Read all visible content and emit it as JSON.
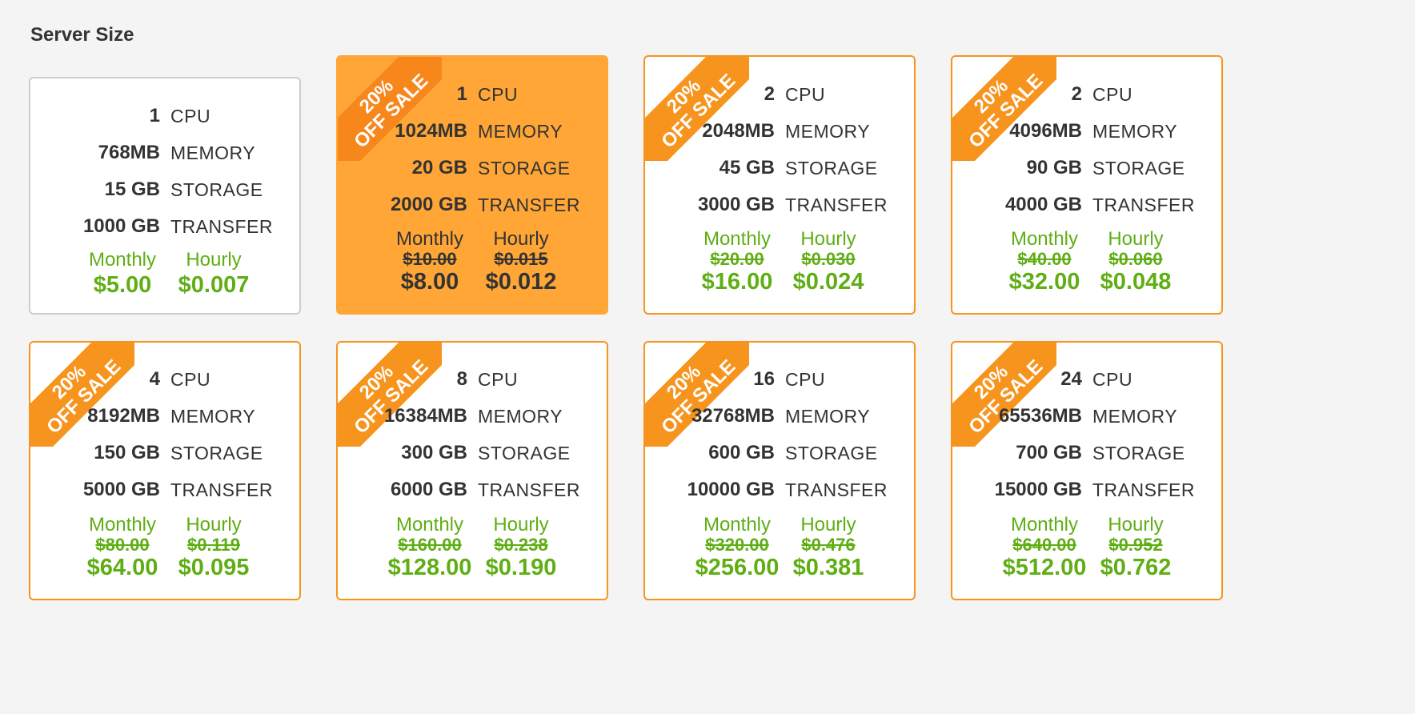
{
  "section": {
    "title": "Server Size"
  },
  "labels": {
    "cpu": "CPU",
    "memory": "MEMORY",
    "storage": "STORAGE",
    "transfer": "TRANSFER",
    "monthly": "Monthly",
    "hourly": "Hourly",
    "ribbon_line1": "20%",
    "ribbon_line2": "OFF SALE"
  },
  "colors": {
    "accent_orange": "#f7941d",
    "selected_bg": "#ffa636",
    "price_green": "#5fae14",
    "border_gray": "#c9ced1"
  },
  "plans": [
    {
      "cpu": "1",
      "memory": "768MB",
      "storage": "15 GB",
      "transfer": "1000 GB",
      "monthly_old": "",
      "hourly_old": "",
      "monthly": "$5.00",
      "hourly": "$0.007",
      "sale": false,
      "selected": false
    },
    {
      "cpu": "1",
      "memory": "1024MB",
      "storage": "20 GB",
      "transfer": "2000 GB",
      "monthly_old": "$10.00",
      "hourly_old": "$0.015",
      "monthly": "$8.00",
      "hourly": "$0.012",
      "sale": true,
      "selected": true
    },
    {
      "cpu": "2",
      "memory": "2048MB",
      "storage": "45 GB",
      "transfer": "3000 GB",
      "monthly_old": "$20.00",
      "hourly_old": "$0.030",
      "monthly": "$16.00",
      "hourly": "$0.024",
      "sale": true,
      "selected": false
    },
    {
      "cpu": "2",
      "memory": "4096MB",
      "storage": "90 GB",
      "transfer": "4000 GB",
      "monthly_old": "$40.00",
      "hourly_old": "$0.060",
      "monthly": "$32.00",
      "hourly": "$0.048",
      "sale": true,
      "selected": false
    },
    {
      "cpu": "4",
      "memory": "8192MB",
      "storage": "150 GB",
      "transfer": "5000 GB",
      "monthly_old": "$80.00",
      "hourly_old": "$0.119",
      "monthly": "$64.00",
      "hourly": "$0.095",
      "sale": true,
      "selected": false
    },
    {
      "cpu": "8",
      "memory": "16384MB",
      "storage": "300 GB",
      "transfer": "6000 GB",
      "monthly_old": "$160.00",
      "hourly_old": "$0.238",
      "monthly": "$128.00",
      "hourly": "$0.190",
      "sale": true,
      "selected": false
    },
    {
      "cpu": "16",
      "memory": "32768MB",
      "storage": "600 GB",
      "transfer": "10000 GB",
      "monthly_old": "$320.00",
      "hourly_old": "$0.476",
      "monthly": "$256.00",
      "hourly": "$0.381",
      "sale": true,
      "selected": false
    },
    {
      "cpu": "24",
      "memory": "65536MB",
      "storage": "700 GB",
      "transfer": "15000 GB",
      "monthly_old": "$640.00",
      "hourly_old": "$0.952",
      "monthly": "$512.00",
      "hourly": "$0.762",
      "sale": true,
      "selected": false
    }
  ]
}
